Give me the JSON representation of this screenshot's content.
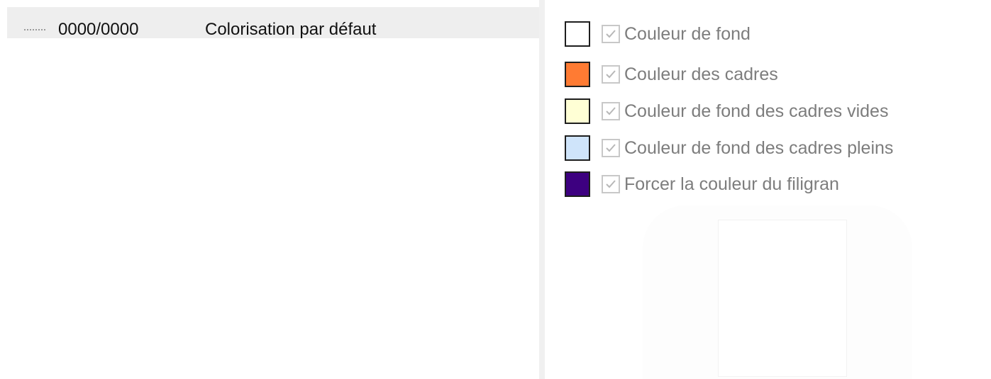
{
  "tree": {
    "rows": [
      {
        "code": "0000/0000",
        "label": "Colorisation par défaut"
      }
    ]
  },
  "options": [
    {
      "label": "Couleur de fond",
      "color": "#ffffff",
      "checked": true,
      "icon": "check-icon"
    },
    {
      "label": "Couleur des cadres",
      "color": "#ff7b33",
      "checked": true,
      "icon": "check-icon"
    },
    {
      "label": "Couleur de fond des cadres vides",
      "color": "#ffffd5",
      "checked": true,
      "icon": "check-icon"
    },
    {
      "label": "Couleur de fond des cadres pleins",
      "color": "#cfe4fa",
      "checked": true,
      "icon": "check-icon"
    },
    {
      "label": "Forcer la couleur du filigran",
      "color": "#3d0080",
      "checked": true,
      "icon": "check-icon"
    }
  ]
}
